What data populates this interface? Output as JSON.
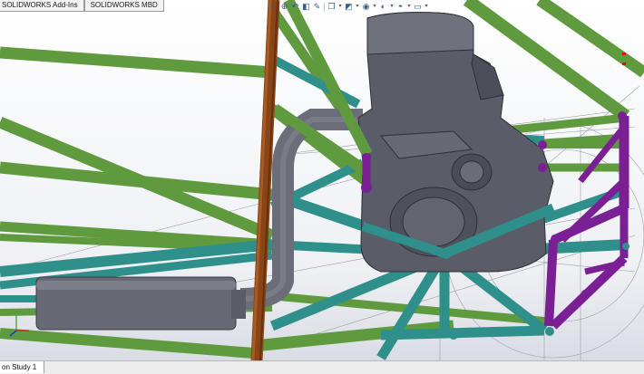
{
  "command_manager": {
    "tabs": [
      {
        "label": "SOLIDWORKS Add-Ins"
      },
      {
        "label": "SOLIDWORKS MBD"
      }
    ]
  },
  "heads_up_toolbar": {
    "icons": [
      "zoom-to-fit-icon",
      "zoom-to-area-icon",
      "previous-view-icon",
      "section-view-icon",
      "dynamic-annotation-icon",
      "view-orientation-icon",
      "display-style-icon",
      "hide-show-items-icon",
      "edit-appearance-icon",
      "apply-scene-icon",
      "view-settings-icon"
    ]
  },
  "study_tabs": {
    "active": "on Study 1"
  },
  "colors": {
    "frame_green": "#5f9a3e",
    "frame_teal": "#2f8f8a",
    "frame_purple": "#7a1f94",
    "frame_brown": "#8a4516",
    "engine_gray": "#5a5d68",
    "exhaust_gray": "#6b6e78",
    "axis_x": "#d11",
    "axis_y": "#2a2",
    "axis_z": "#22d"
  }
}
